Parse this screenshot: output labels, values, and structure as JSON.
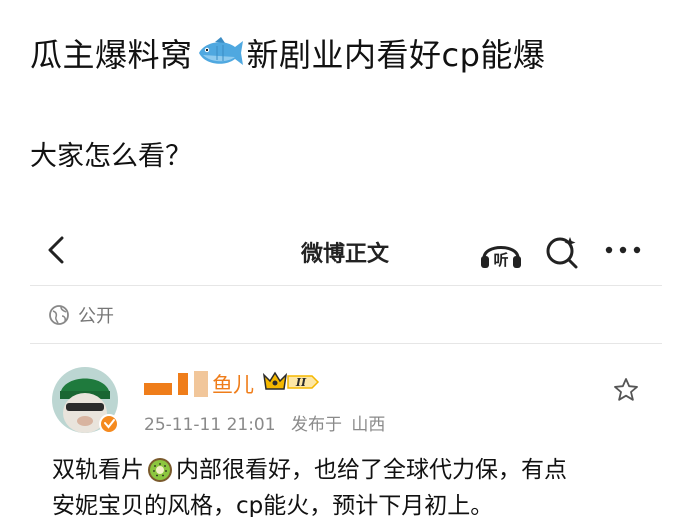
{
  "post": {
    "title_prefix": "瓜主爆料窝",
    "title_suffix": "新剧业内看好cp能爆",
    "question": "大家怎么看？"
  },
  "weibo": {
    "nav_title": "微博正文",
    "listen_label": "听",
    "visibility_label": "公开",
    "user": {
      "name_visible": "鱼儿",
      "vip_level": "II"
    },
    "meta": {
      "timestamp": "25-11-11 21:01",
      "location_prefix": "发布于",
      "location": "山西"
    },
    "body_line1_a": "双轨看片",
    "body_line1_b": "内部很看好，也给了全球代力保，有点",
    "body_line2": "安妮宝贝的风格，cp能火，预计下月初上。"
  },
  "colors": {
    "username": "#ef7d1a",
    "vip_gold": "#f5b800",
    "verified_orange": "#f58a1f",
    "muted_text": "#8a8a8a"
  },
  "icons": [
    "fish-emoji-icon",
    "back-arrow-icon",
    "listen-icon",
    "search-icon",
    "more-icon",
    "globe-icon",
    "avatar",
    "vip-crown-icon",
    "verified-badge-icon",
    "star-icon",
    "kiwi-emoji-icon"
  ]
}
